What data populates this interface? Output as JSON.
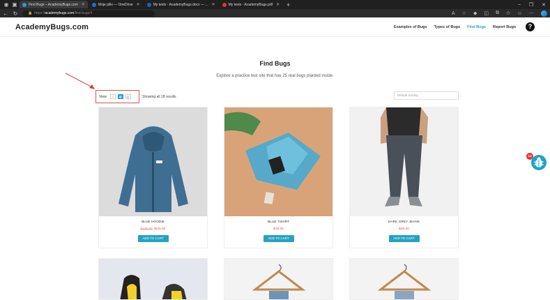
{
  "browser": {
    "tabs": [
      {
        "title": "Find Bugs – AcademyBugs.com",
        "active": true,
        "color": "#3c8fd8"
      },
      {
        "title": "Moje pliki — OneDrive",
        "active": false,
        "color": "#1f6fcf"
      },
      {
        "title": "My tests - AcademyBugs.docx — ...",
        "active": false,
        "color": "#2b5fb0"
      },
      {
        "title": "My tests - AcademyBugs.pdf",
        "active": false,
        "color": "#d33b3b"
      }
    ],
    "url_scheme": "https://",
    "url_host": "academybugs.com",
    "url_path": "/find-bugs/#"
  },
  "header": {
    "logo": "AcademyBugs.com",
    "menu": [
      "Examples of Bugs",
      "Types of Bugs",
      "Find Bugs",
      "Report Bugs"
    ],
    "active_menu": "Find Bugs",
    "accent": "#23a3c4"
  },
  "page": {
    "title": "Find Bugs",
    "subtitle": "Explore a practice test site that has 25 real bugs planted inside."
  },
  "toolbar": {
    "view_label": "View",
    "result_count": "Showing all 18 results",
    "sorting": "Default Sorting"
  },
  "products": [
    {
      "name": "BLUE HOODIE",
      "old_price": "$146.00",
      "price": "$111.00",
      "button": "ADD TO CART"
    },
    {
      "name": "BLUE TSHIRT",
      "old_price": "",
      "price": "$79.00",
      "button": "ADD TO CART"
    },
    {
      "name": "DARK GREY JEANS",
      "old_price": "",
      "price": "$46.00",
      "button": "ADD TO CART"
    }
  ],
  "bug_widget": {
    "count": "14"
  }
}
